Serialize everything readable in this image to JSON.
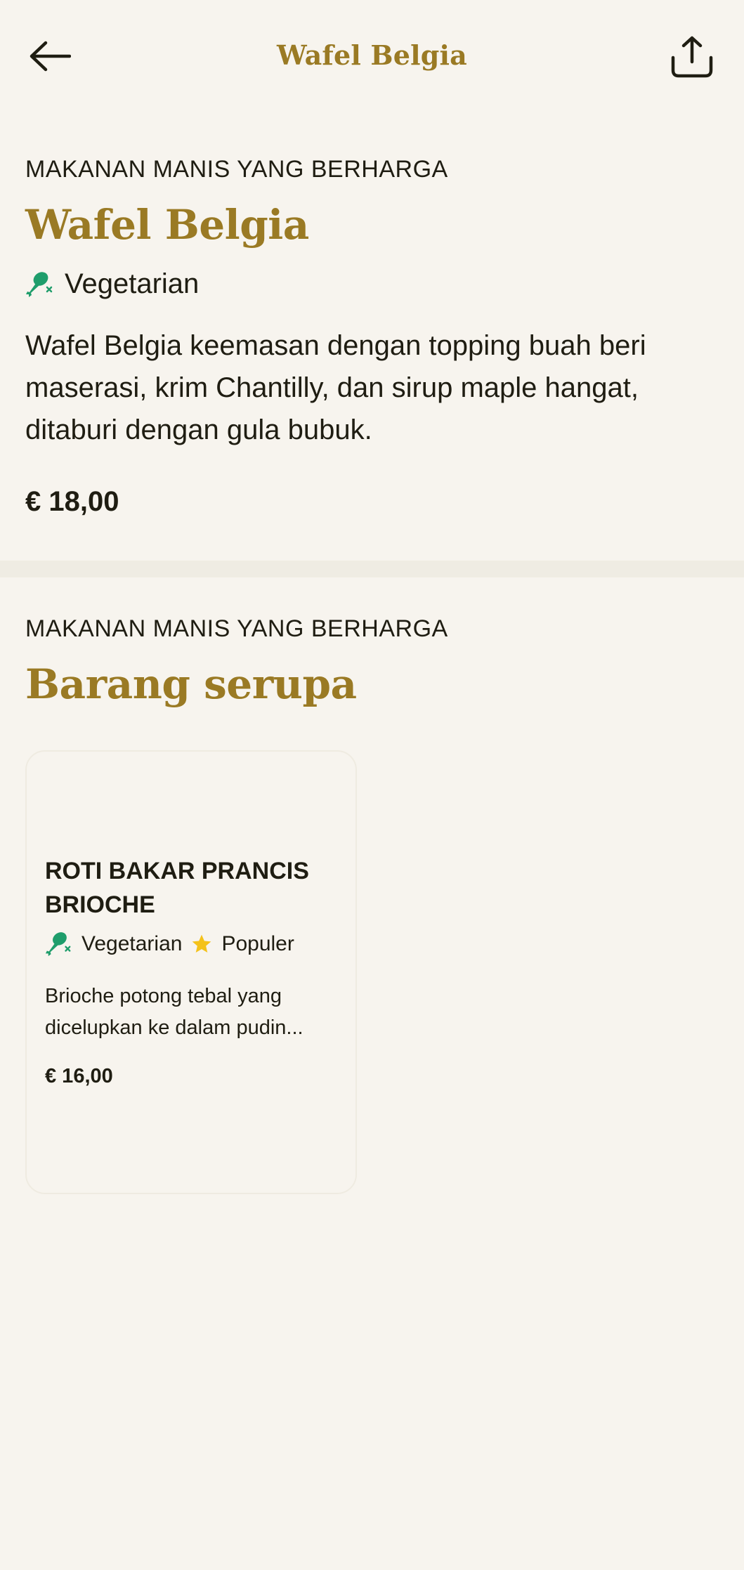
{
  "header": {
    "title": "Wafel Belgia",
    "back_icon": "arrow-left-icon",
    "share_icon": "share-icon"
  },
  "item": {
    "category": "MAKANAN MANIS YANG BERHARGA",
    "name": "Wafel Belgia",
    "tag": "Vegetarian",
    "tag_icon": "vegetarian-drumstick-icon",
    "description": "Wafel Belgia keemasan dengan topping buah beri maserasi, krim Chantilly, dan sirup maple hangat, ditaburi dengan gula bubuk.",
    "price": "€ 18,00"
  },
  "similar": {
    "category": "MAKANAN MANIS YANG BERHARGA",
    "heading": "Barang serupa",
    "items": [
      {
        "name": "ROTI BAKAR PRANCIS BRIOCHE",
        "tags": [
          "Vegetarian",
          "Populer"
        ],
        "tag_icons": [
          "vegetarian-drumstick-icon",
          "star-icon"
        ],
        "description": "Brioche potong tebal yang dicelupkan ke dalam pudin...",
        "price": "€ 16,00"
      }
    ]
  },
  "colors": {
    "background": "#f7f4ee",
    "accent_gold": "#9a7a24",
    "text": "#1f1d12",
    "vegetarian_green": "#1f9d6b",
    "star_yellow": "#f4c21a",
    "divider": "#efece3"
  }
}
